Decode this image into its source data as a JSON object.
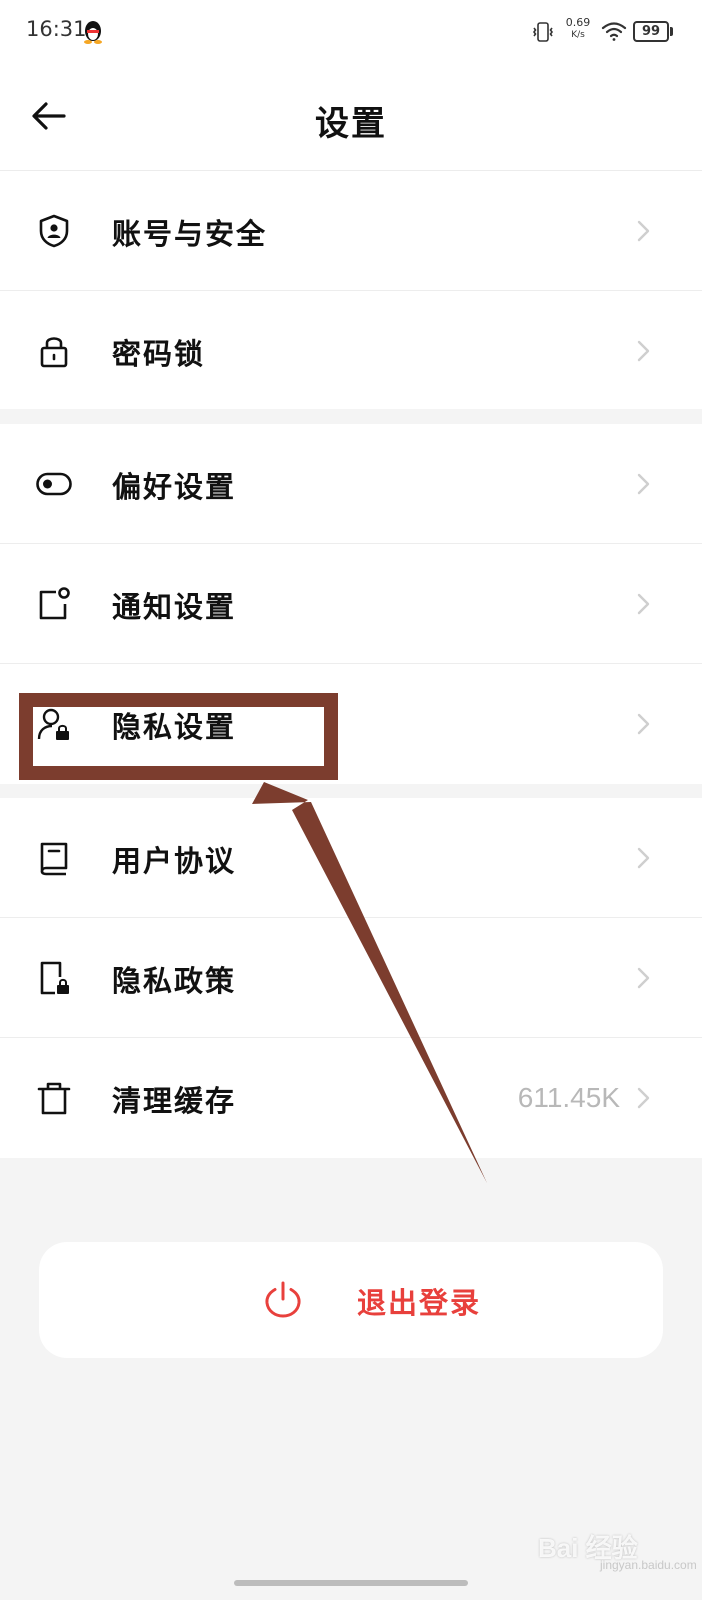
{
  "status_bar": {
    "time": "16:31",
    "net_speed_value": "0.69",
    "net_speed_unit": "K/s",
    "battery_level": "99"
  },
  "header": {
    "title": "设置"
  },
  "groups": [
    {
      "items": [
        {
          "label": "账号与安全",
          "icon": "shield-user-icon"
        },
        {
          "label": "密码锁",
          "icon": "lock-icon"
        }
      ]
    },
    {
      "items": [
        {
          "label": "偏好设置",
          "icon": "toggle-icon"
        },
        {
          "label": "通知设置",
          "icon": "notification-icon"
        },
        {
          "label": "隐私设置",
          "icon": "user-lock-icon"
        }
      ]
    },
    {
      "items": [
        {
          "label": "用户协议",
          "icon": "book-icon"
        },
        {
          "label": "隐私政策",
          "icon": "document-lock-icon"
        },
        {
          "label": "清理缓存",
          "icon": "trash-icon",
          "value": "611.45K"
        }
      ]
    }
  ],
  "logout": {
    "label": "退出登录",
    "icon": "power-icon"
  },
  "annotation": {
    "highlight_color": "#7c3d2e"
  },
  "watermark": {
    "text": "Bai 经验",
    "sub": "jingyan.baidu.com"
  },
  "colors": {
    "background": "#f4f4f4",
    "logout_red": "#e8403c",
    "value_gray": "#b8b8b8"
  }
}
